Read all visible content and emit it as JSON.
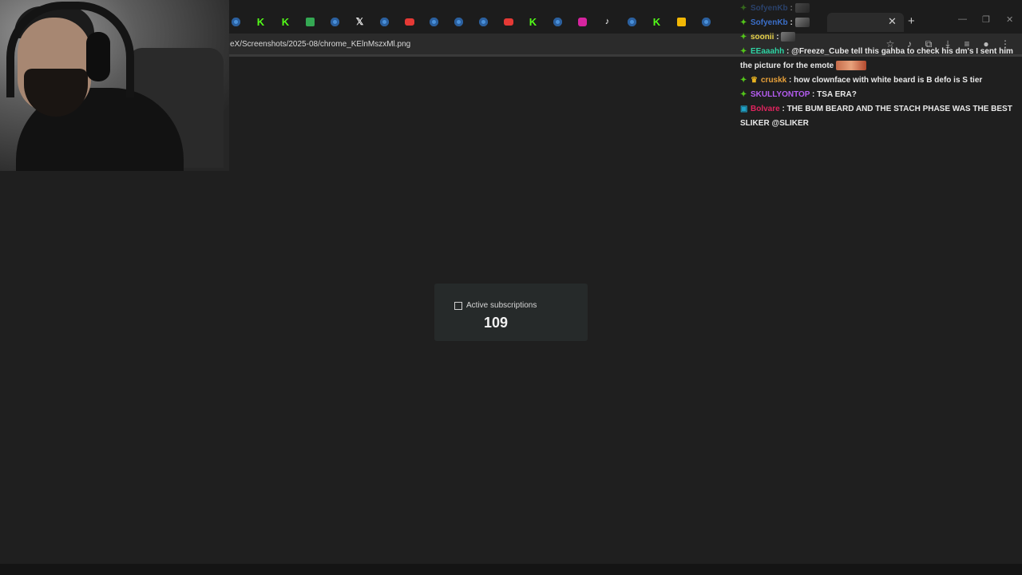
{
  "browser": {
    "url": "eX/Screenshots/2025-08/chrome_KElnMszxMl.png",
    "tab_icons": [
      "chrome-icon",
      "k-icon",
      "k-icon",
      "green-icon",
      "chrome-icon",
      "x-icon",
      "chrome-icon",
      "youtube-icon",
      "chrome-icon",
      "chrome-icon",
      "chrome-icon",
      "youtube-icon",
      "k-icon",
      "chrome-icon",
      "instagram-icon",
      "tiktok-icon",
      "chrome-icon",
      "k-icon",
      "yellow-icon",
      "chrome-icon"
    ],
    "new_tab_label": "+",
    "close_tab_label": "✕"
  },
  "chat": {
    "messages": [
      {
        "user": "SofyenKb",
        "user_color": "#3b6fc9",
        "text": ":",
        "faded": true,
        "badge": "diamond",
        "emote": true
      },
      {
        "user": "SofyenKb",
        "user_color": "#3b6fc9",
        "text": ":",
        "faded": false,
        "badge": "diamond",
        "emote": true
      },
      {
        "user": "soonii",
        "user_color": "#e8d24a",
        "text": ":",
        "faded": false,
        "badge": "diamond",
        "emote": true
      },
      {
        "user": "EEaaahh",
        "user_color": "#2fd4a4",
        "text": ": @Freeze_Cube tell this gahba to check his dm's I sent him the picture for the emote",
        "faded": false,
        "badge": "diamond",
        "emote_wide": true
      },
      {
        "user": "cruskk",
        "user_color": "#e8a13a",
        "text": ": how clownface with white beard is B defo is S tier",
        "faded": false,
        "badge": "diamond-crown"
      },
      {
        "user": "SKULLYONTOP",
        "user_color": "#b45cf0",
        "text": ": TSA ERA?",
        "faded": false,
        "badge": "diamond"
      },
      {
        "user": "Bolvare",
        "user_color": "#e0245e",
        "text": ": THE BUM BEARD AND THE STACH PHASE WAS THE BEST SLIKER @SLIKER",
        "faded": false,
        "badge": "square"
      }
    ]
  },
  "card": {
    "label": "Active subscriptions",
    "value": "109",
    "icon": "chart-icon"
  }
}
